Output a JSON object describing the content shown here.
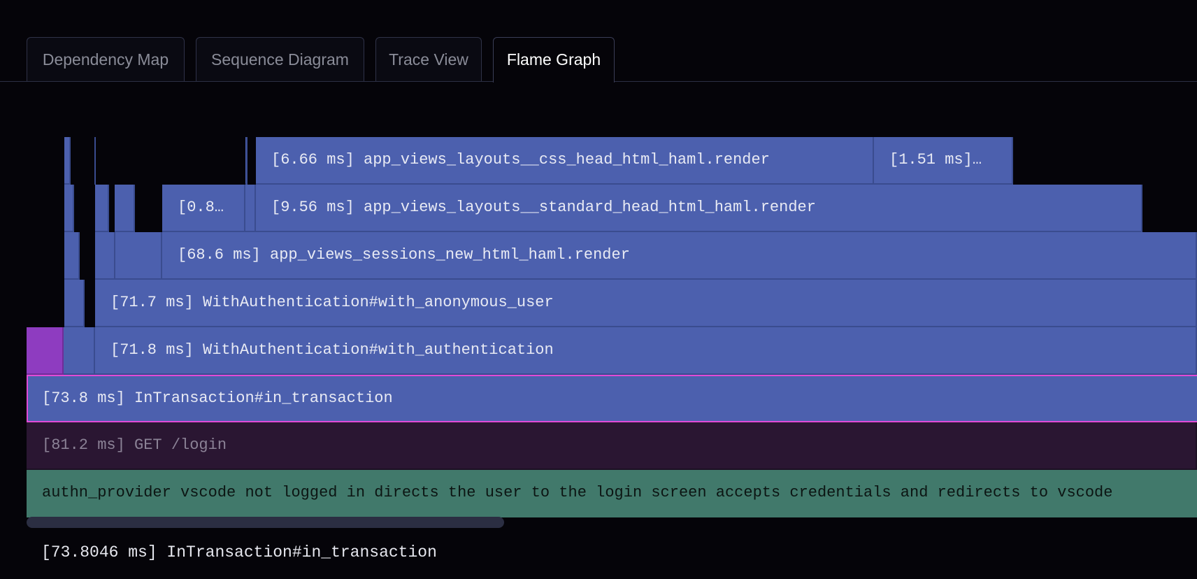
{
  "tabs": [
    {
      "label": "Dependency Map",
      "active": false
    },
    {
      "label": "Sequence Diagram",
      "active": false
    },
    {
      "label": "Trace View",
      "active": false
    },
    {
      "label": "Flame Graph",
      "active": true
    }
  ],
  "flame_graph": {
    "frames": {
      "css_head_render": "[6.66 ms] app_views_layouts__css_head_html_haml.render",
      "small_render_1_51": "[1.51 ms]…",
      "small_render_0_8": "[0.8…",
      "standard_head_render": "[9.56 ms] app_views_layouts__standard_head_html_haml.render",
      "sessions_new_render": "[68.6 ms] app_views_sessions_new_html_haml.render",
      "with_anonymous_user": "[71.7 ms] WithAuthentication#with_anonymous_user",
      "with_authentication": "[71.8 ms] WithAuthentication#with_authentication",
      "in_transaction": "[73.8 ms] InTransaction#in_transaction",
      "get_login": "[81.2 ms] GET /login",
      "test_case": "authn_provider vscode not logged in directs the user to the login screen accepts credentials and redirects to vscode"
    },
    "selected": "in_transaction"
  },
  "detail": {
    "text": "[73.8046 ms] InTransaction#in_transaction"
  },
  "colors": {
    "background": "#050409",
    "frame": "#4c60ae",
    "frame_purple": "#8e3cc0",
    "selected_border": "#e14bd7",
    "request_frame": "#2a1632",
    "test_frame": "#41796b"
  }
}
